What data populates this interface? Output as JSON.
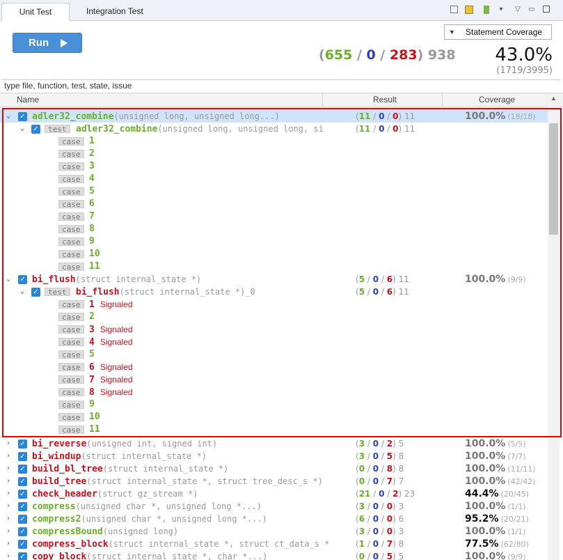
{
  "tabs": [
    "Unit Test",
    "Integration Test"
  ],
  "toolbar": {
    "icons": [
      "collapse-icon",
      "filter-icon",
      "report-icon",
      "dropdown-icon",
      "minimize-icon",
      "maximize-icon"
    ]
  },
  "coverage_select": {
    "value": "Statement Coverage"
  },
  "run": {
    "label": "Run"
  },
  "stats": {
    "pass": "655",
    "unknown": "0",
    "fail": "283",
    "total": "938",
    "percent": "43.0%",
    "fraction": "(1719/3995)"
  },
  "filter": {
    "placeholder": "type file, function, test, state, issue"
  },
  "columns": {
    "name": "Name",
    "result": "Result",
    "coverage": "Coverage"
  },
  "colors": {
    "pass": "#6aae2a",
    "unknown": "#2b3fbf",
    "fail": "#c4121c",
    "accent": "#4a90d9",
    "highlight": "#e00000"
  },
  "tree": {
    "adler": {
      "name": "adler32_combine",
      "sig": "(unsigned long, unsigned long...)",
      "p": "11",
      "u": "0",
      "f": "0",
      "t": "11",
      "cov": "100.0%",
      "frac": "(18/18)",
      "test": {
        "tag": "test",
        "name": "adler32_combine",
        "sig": "(unsigned long, unsigned long, si",
        "p": "11",
        "u": "0",
        "f": "0",
        "t": "11"
      }
    },
    "biflush": {
      "name": "bi_flush",
      "sig": "(struct internal_state *)",
      "p": "5",
      "u": "0",
      "f": "6",
      "t": "11",
      "cov": "100.0%",
      "frac": "(9/9)",
      "test": {
        "tag": "test",
        "name": "bi_flush",
        "sig": "(struct internal_state *)_0",
        "p": "5",
        "u": "0",
        "f": "6",
        "t": "11"
      }
    },
    "case_tag": "case",
    "signaled": "Signaled",
    "funcs": [
      {
        "name": "bi_reverse",
        "sig": "(unsigned int, signed int)",
        "p": "3",
        "u": "0",
        "f": "2",
        "t": "5",
        "cov": "100.0%",
        "frac": "(5/5)"
      },
      {
        "name": "bi_windup",
        "sig": "(struct internal_state *)",
        "p": "3",
        "u": "0",
        "f": "5",
        "t": "8",
        "cov": "100.0%",
        "frac": "(7/7)"
      },
      {
        "name": "build_bl_tree",
        "sig": "(struct internal_state *)",
        "p": "0",
        "u": "0",
        "f": "8",
        "t": "8",
        "cov": "100.0%",
        "frac": "(11/11)"
      },
      {
        "name": "build_tree",
        "sig": "(struct internal_state *, struct tree_desc_s *)",
        "p": "0",
        "u": "0",
        "f": "7",
        "t": "7",
        "cov": "100.0%",
        "frac": "(42/42)"
      },
      {
        "name": "check_header",
        "sig": "(struct gz_stream *)",
        "p": "21",
        "u": "0",
        "f": "2",
        "t": "23",
        "cov": "44.4%",
        "frac": "(20/45)"
      },
      {
        "name": "compress",
        "sig": "(unsigned char *, unsigned long *...)",
        "p": "3",
        "u": "0",
        "f": "0",
        "t": "3",
        "cov": "100.0%",
        "frac": "(1/1)"
      },
      {
        "name": "compress2",
        "sig": "(unsigned char *, unsigned long *...)",
        "p": "6",
        "u": "0",
        "f": "0",
        "t": "6",
        "cov": "95.2%",
        "frac": "(20/21)"
      },
      {
        "name": "compressBound",
        "sig": "(unsigned long)",
        "p": "3",
        "u": "0",
        "f": "0",
        "t": "3",
        "cov": "100.0%",
        "frac": "(1/1)"
      },
      {
        "name": "compress_block",
        "sig": "(struct internal_state *, struct ct_data_s *",
        "p": "1",
        "u": "0",
        "f": "7",
        "t": "8",
        "cov": "77.5%",
        "frac": "(62/80)"
      },
      {
        "name": "copy_block",
        "sig": "(struct internal_state *, char *...)",
        "p": "0",
        "u": "0",
        "f": "5",
        "t": "5",
        "cov": "100.0%",
        "frac": "(9/9)"
      }
    ]
  },
  "adler_cases": [
    "1",
    "2",
    "3",
    "4",
    "5",
    "6",
    "7",
    "8",
    "9",
    "10",
    "11"
  ],
  "biflush_cases": [
    {
      "n": "1",
      "s": true
    },
    {
      "n": "2",
      "s": false
    },
    {
      "n": "3",
      "s": true
    },
    {
      "n": "4",
      "s": true
    },
    {
      "n": "5",
      "s": false
    },
    {
      "n": "6",
      "s": true
    },
    {
      "n": "7",
      "s": true
    },
    {
      "n": "8",
      "s": true
    },
    {
      "n": "9",
      "s": false
    },
    {
      "n": "10",
      "s": false
    },
    {
      "n": "11",
      "s": false
    }
  ]
}
